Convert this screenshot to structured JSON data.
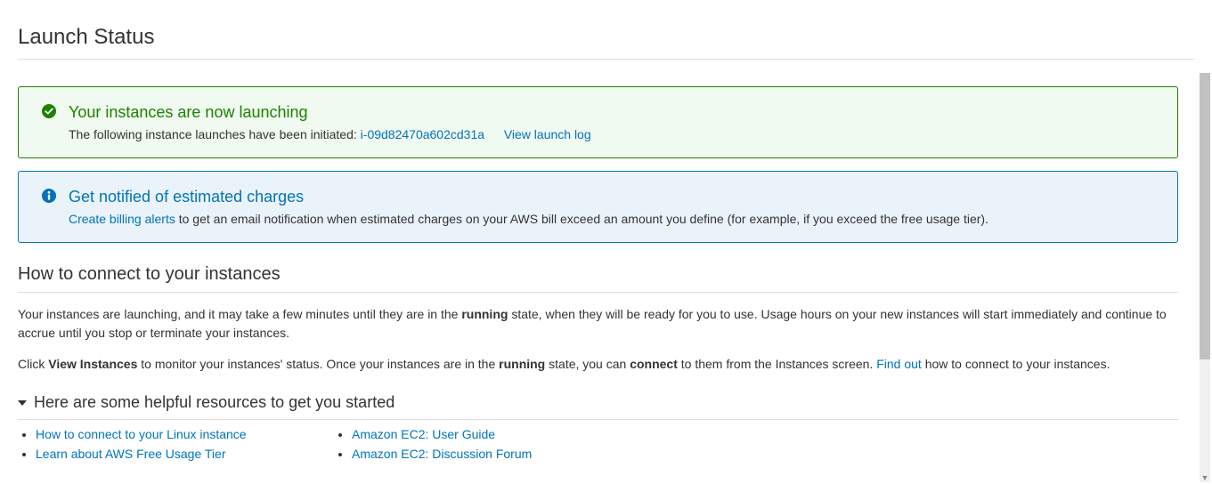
{
  "page_title": "Launch Status",
  "success_alert": {
    "title": "Your instances are now launching",
    "body_prefix": "The following instance launches have been initiated: ",
    "instance_id": "i-09d82470a602cd31a",
    "view_log": "View launch log"
  },
  "info_alert": {
    "title": "Get notified of estimated charges",
    "link": "Create billing alerts",
    "body_suffix": " to get an email notification when estimated charges on your AWS bill exceed an amount you define (for example, if you exceed the free usage tier)."
  },
  "connect_section": {
    "heading": "How to connect to your instances",
    "p1_a": "Your instances are launching, and it may take a few minutes until they are in the ",
    "p1_b": "running",
    "p1_c": " state, when they will be ready for you to use. Usage hours on your new instances will start immediately and continue to accrue until you stop or terminate your instances.",
    "p2_a": "Click ",
    "p2_b": "View Instances",
    "p2_c": " to monitor your instances' status. Once your instances are in the ",
    "p2_d": "running",
    "p2_e": " state, you can ",
    "p2_f": "connect",
    "p2_g": " to them from the Instances screen. ",
    "p2_link": "Find out",
    "p2_h": " how to connect to your instances."
  },
  "resources": {
    "heading": "Here are some helpful resources to get you started",
    "col1": [
      "How to connect to your Linux instance",
      "Learn about AWS Free Usage Tier"
    ],
    "col2": [
      "Amazon EC2: User Guide",
      "Amazon EC2: Discussion Forum"
    ]
  }
}
